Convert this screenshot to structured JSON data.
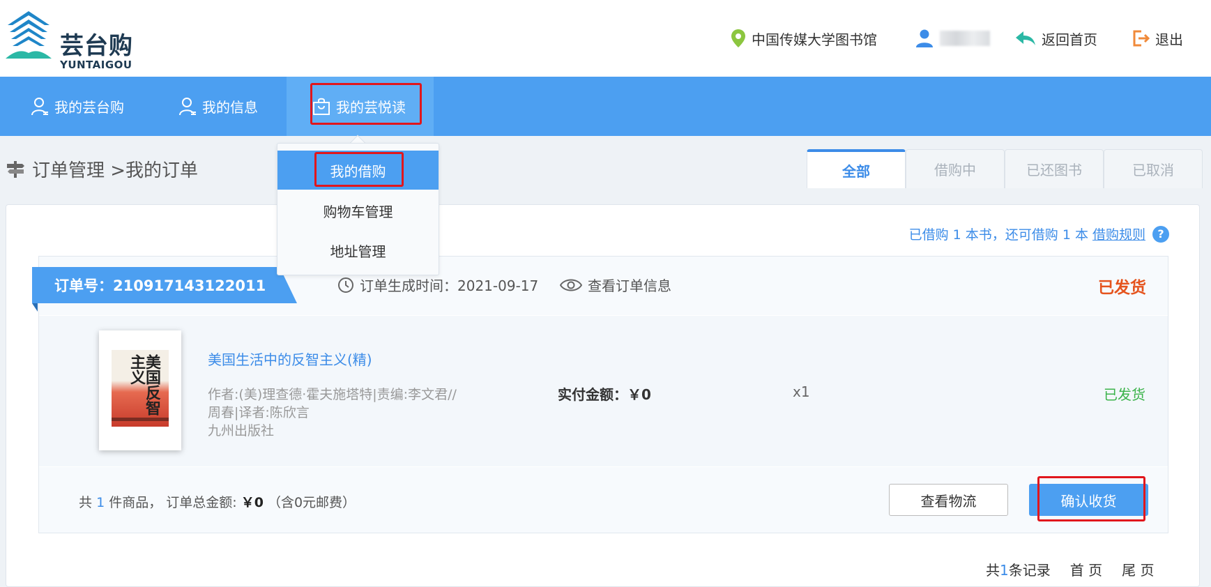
{
  "header": {
    "logo_text": "芸台购",
    "logo_sub": "YUNTAIGOU",
    "library": "中国传媒大学图书馆",
    "user_name": "",
    "home_label": "返回首页",
    "logout_label": "退出"
  },
  "nav": {
    "items": [
      {
        "label": "我的芸台购",
        "icon": "user-icon"
      },
      {
        "label": "我的信息",
        "icon": "user-icon"
      },
      {
        "label": "我的芸悦读",
        "icon": "bag-icon"
      }
    ],
    "dropdown": [
      "我的借购",
      "购物车管理",
      "地址管理"
    ]
  },
  "breadcrumb": "订单管理 >我的订单",
  "tabs": [
    "全部",
    "借购中",
    "已还图书",
    "已取消"
  ],
  "borrow_info": {
    "text": "已借购 1 本书，还可借购 1 本",
    "rule_link": "借购规则",
    "help": "?"
  },
  "order": {
    "number_label": "订单号：210917143122011",
    "created_label": "订单生成时间：2021-09-17",
    "view_info": "查看订单信息",
    "status": "已发货",
    "item": {
      "title": "美国生活中的反智主义(精)",
      "cover_title": "美国反智主义",
      "desc_line1": "作者:(美)理查德·霍夫施塔特|责编:李文君//",
      "desc_line2": "周春|译者:陈欣言",
      "desc_line3": "九州出版社",
      "pay_label": "实付金额：￥0",
      "qty": "x1",
      "status": "已发货"
    },
    "summary": {
      "prefix": "共",
      "count": "1",
      "suffix": "件商品，  订单总金额: ",
      "amount": "￥0",
      "shipping": " （含0元邮费）"
    },
    "btn_logistics": "查看物流",
    "btn_confirm": "确认收货"
  },
  "pager": {
    "prefix": "共",
    "count": "1",
    "suffix": "条记录",
    "first": "首 页",
    "last": "尾 页"
  },
  "colors": {
    "brand_blue": "#4c9ff1",
    "status_orange": "#e5541e",
    "status_green": "#3bb34a",
    "highlight_red": "#e1161c"
  }
}
